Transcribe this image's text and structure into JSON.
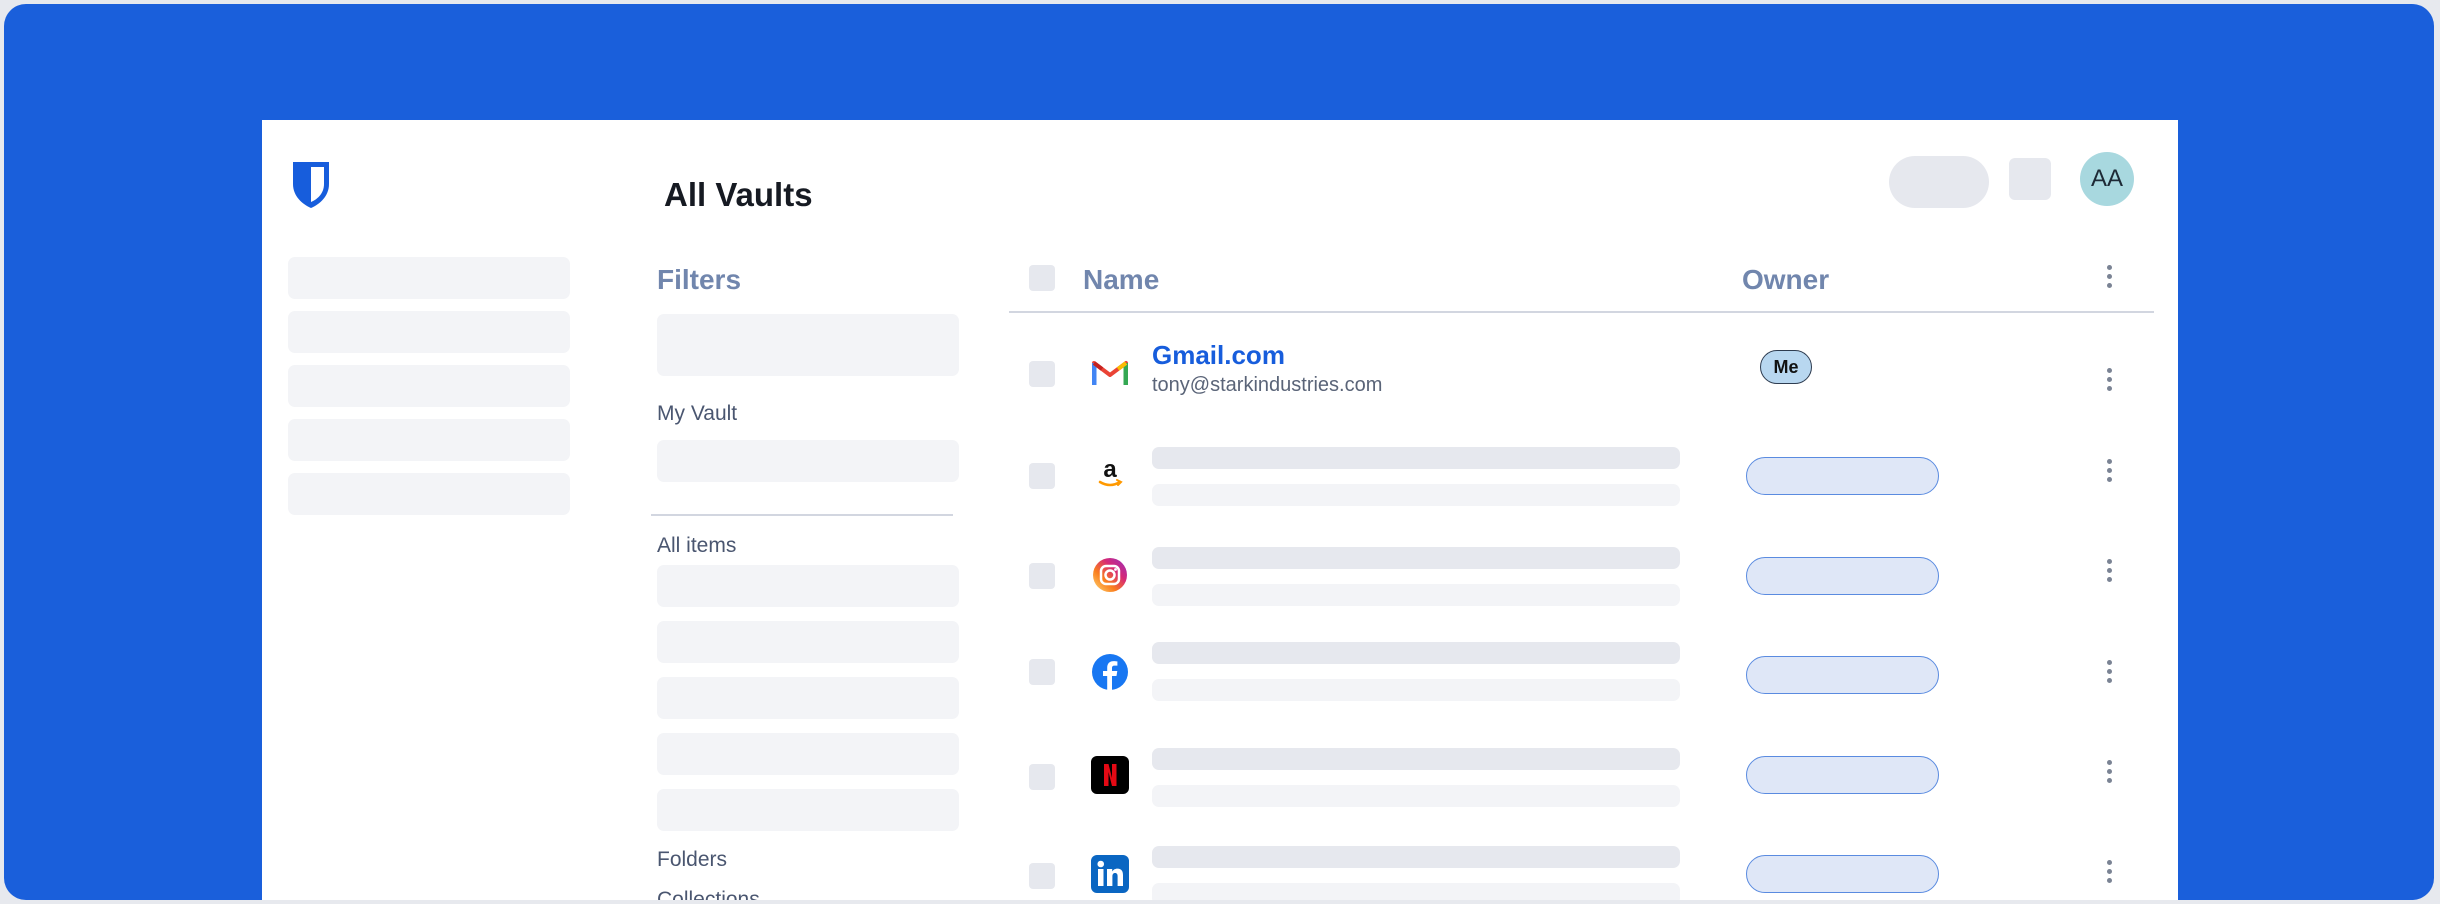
{
  "header": {
    "title": "All Vaults",
    "avatar_initials": "AA"
  },
  "filters": {
    "title": "Filters",
    "sections": {
      "my_vault": "My Vault",
      "all_items": "All items",
      "folders": "Folders",
      "collections": "Collections"
    }
  },
  "table": {
    "columns": {
      "name": "Name",
      "owner": "Owner"
    },
    "rows": [
      {
        "icon": "gmail-icon",
        "name": "Gmail.com",
        "username": "tony@starkindustries.com",
        "owner": "Me"
      },
      {
        "icon": "amazon-icon"
      },
      {
        "icon": "instagram-icon"
      },
      {
        "icon": "facebook-icon"
      },
      {
        "icon": "netflix-icon"
      },
      {
        "icon": "linkedin-icon"
      }
    ]
  },
  "colors": {
    "brand": "#175DDC",
    "frame_background": "#1A5FDB"
  }
}
